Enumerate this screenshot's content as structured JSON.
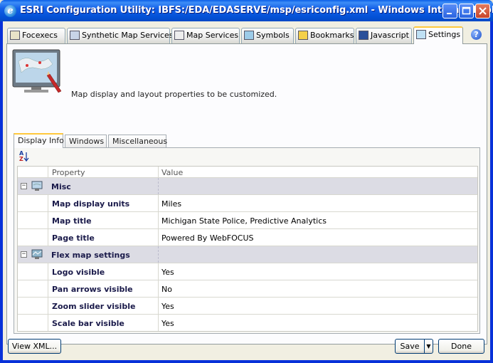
{
  "window": {
    "title": "ESRI Configuration Utility: IBFS:/EDA/EDASERVE/msp/esriconfig.xml - Windows Internet Explorer",
    "ie_icon_glyph": "e",
    "min_glyph": "▁",
    "max_glyph": "□",
    "close_glyph": "✕"
  },
  "tabs": [
    {
      "label": "Focexecs",
      "icon": "focexec-icon"
    },
    {
      "label": "Synthetic Map Services",
      "icon": "synthetic-map-icon"
    },
    {
      "label": "Map Services",
      "icon": "map-services-icon"
    },
    {
      "label": "Symbols",
      "icon": "symbols-icon"
    },
    {
      "label": "Bookmarks",
      "icon": "bookmarks-icon"
    },
    {
      "label": "Javascript",
      "icon": "javascript-icon"
    },
    {
      "label": "Settings",
      "icon": "settings-icon",
      "active": true
    }
  ],
  "help_glyph": "?",
  "header": {
    "description": "Map display and layout properties to be customized."
  },
  "inner_tabs": [
    {
      "label": "Display Info",
      "active": true
    },
    {
      "label": "Windows"
    },
    {
      "label": "Miscellaneous"
    }
  ],
  "grid": {
    "col_property": "Property",
    "col_value": "Value",
    "categories": [
      {
        "name": "Misc",
        "expander": "−",
        "rows": [
          {
            "property": "Map display units",
            "value": "Miles"
          },
          {
            "property": "Map title",
            "value": "Michigan State Police, Predictive Analytics"
          },
          {
            "property": "Page title",
            "value": "Powered By WebFOCUS"
          }
        ]
      },
      {
        "name": "Flex map settings",
        "expander": "−",
        "rows": [
          {
            "property": "Logo visible",
            "value": "Yes"
          },
          {
            "property": "Pan arrows visible",
            "value": "No"
          },
          {
            "property": "Zoom slider visible",
            "value": "Yes"
          },
          {
            "property": "Scale bar visible",
            "value": "Yes"
          }
        ]
      }
    ]
  },
  "buttons": {
    "view_xml": "View XML...",
    "save": "Save",
    "save_drop": "▼",
    "done": "Done"
  },
  "sort_icon": {
    "top": "A",
    "bottom": "Z"
  },
  "colors": {
    "titlebar": "#0351d6",
    "active_tab_accent": "#ffc83c",
    "category_row": "#dcdce4"
  }
}
